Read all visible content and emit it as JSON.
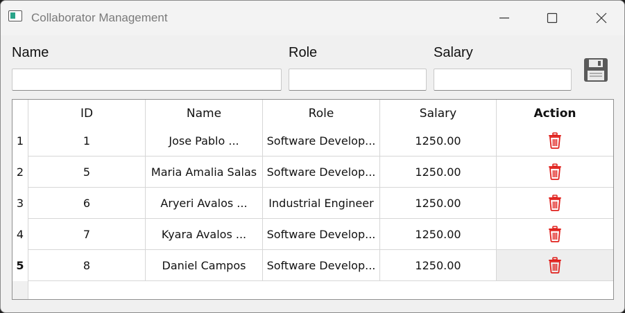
{
  "window": {
    "title": "Collaborator Management",
    "controls": [
      "minimize-icon",
      "maximize-icon",
      "close-icon"
    ]
  },
  "form": {
    "name_label": "Name",
    "name_value": "",
    "role_label": "Role",
    "role_value": "",
    "salary_label": "Salary",
    "salary_value": "",
    "save_icon": "floppy-disk-icon"
  },
  "table": {
    "headers": [
      "ID",
      "Name",
      "Role",
      "Salary",
      "Action"
    ],
    "rows": [
      {
        "num": "1",
        "id": "1",
        "name": "Jose Pablo ...",
        "role": "Software Develop...",
        "salary": "1250.00",
        "action_icon": "trash-icon"
      },
      {
        "num": "2",
        "id": "5",
        "name": "Maria Amalia Salas",
        "role": "Software Develop...",
        "salary": "1250.00",
        "action_icon": "trash-icon"
      },
      {
        "num": "3",
        "id": "6",
        "name": "Aryeri Avalos ...",
        "role": "Industrial Engineer",
        "salary": "1250.00",
        "action_icon": "trash-icon"
      },
      {
        "num": "4",
        "id": "7",
        "name": "Kyara Avalos ...",
        "role": "Software Develop...",
        "salary": "1250.00",
        "action_icon": "trash-icon"
      },
      {
        "num": "5",
        "id": "8",
        "name": "Daniel Campos",
        "role": "Software Develop...",
        "salary": "1250.00",
        "action_icon": "trash-icon"
      }
    ],
    "selected_row_index": 4
  },
  "colors": {
    "trash": "#e0201c",
    "save_icon": "#5a5a5a"
  }
}
